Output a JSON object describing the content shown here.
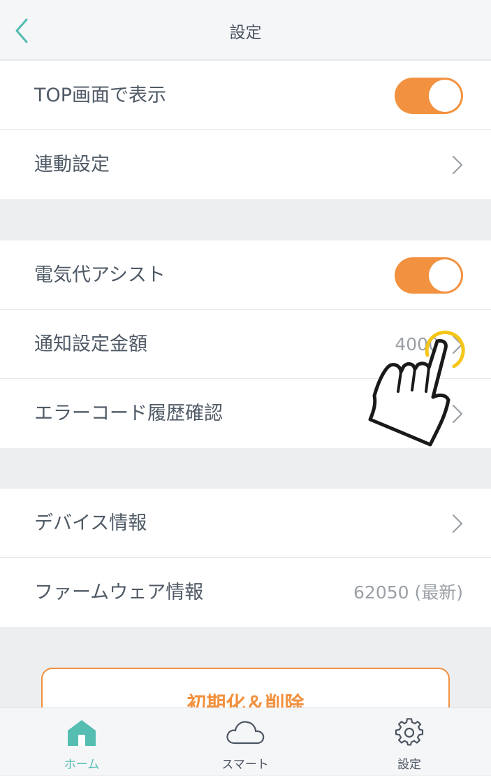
{
  "header": {
    "title": "設定"
  },
  "sections": [
    {
      "items": [
        {
          "label": "TOP画面で表示",
          "toggle": true
        },
        {
          "label": "連動設定"
        }
      ]
    },
    {
      "items": [
        {
          "label": "電気代アシスト",
          "toggle": true
        },
        {
          "label": "通知設定金額",
          "value": "4000"
        },
        {
          "label": "エラーコード履歴確認"
        }
      ]
    },
    {
      "items": [
        {
          "label": "デバイス情報"
        },
        {
          "label": "ファームウェア情報",
          "value": "62050 (最新)"
        }
      ]
    }
  ],
  "reset_button": {
    "label": "初期化＆削除"
  },
  "tabbar": {
    "tabs": [
      {
        "label": "ホーム",
        "icon": "home-icon",
        "active": true
      },
      {
        "label": "スマート",
        "icon": "cloud-icon"
      },
      {
        "label": "設定",
        "icon": "gear-icon"
      }
    ]
  },
  "colors": {
    "accent": "#f2913f",
    "teal": "#55bdb1"
  }
}
